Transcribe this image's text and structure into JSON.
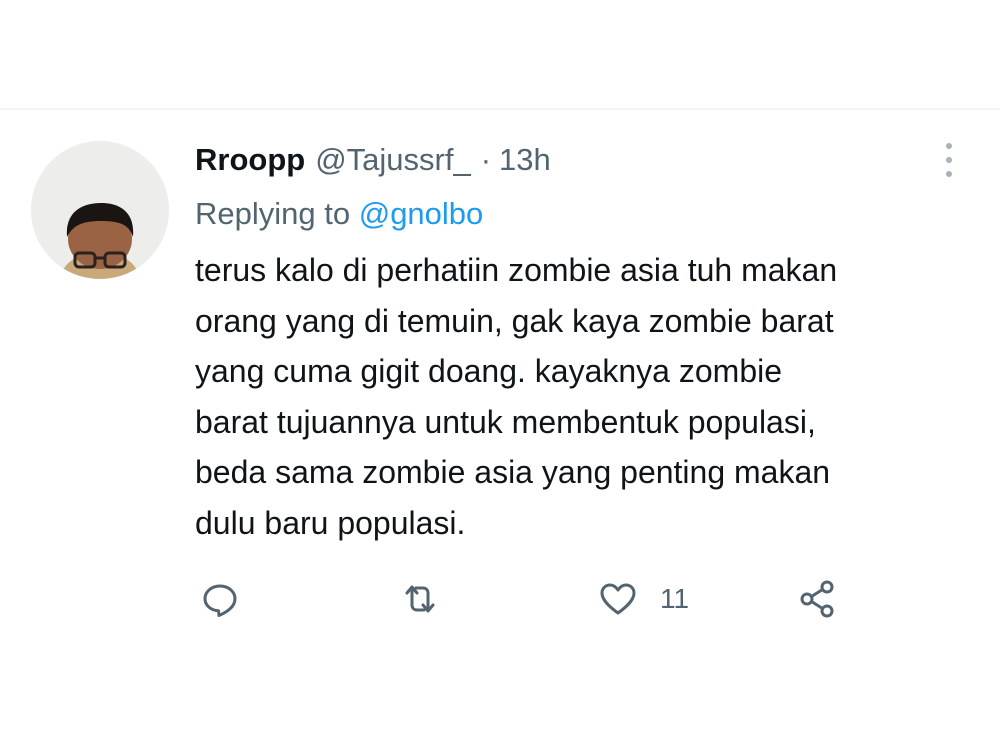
{
  "tweet": {
    "author_name": "Rroopp",
    "author_handle": "@Tajussrf_",
    "separator": "·",
    "time": "13h",
    "replying_prefix": "Replying to ",
    "replying_to": "@gnolbo",
    "text_lines": [
      "terus kalo di perhatiin zombie asia tuh makan",
      "orang yang di temuin, gak kaya zombie barat",
      "yang cuma gigit doang. kayaknya zombie",
      "barat tujuannya untuk membentuk populasi,",
      "beda sama zombie asia yang penting makan",
      "dulu baru populasi."
    ],
    "actions": {
      "reply_icon": "reply-icon",
      "retweet_icon": "retweet-icon",
      "like_icon": "heart-icon",
      "like_count": "11",
      "share_icon": "share-icon"
    },
    "more_icon": "more-vertical-icon"
  },
  "colors": {
    "text_primary": "#0f1419",
    "text_secondary": "#536471",
    "link": "#1d9bf0",
    "divider": "#eff3f4"
  }
}
